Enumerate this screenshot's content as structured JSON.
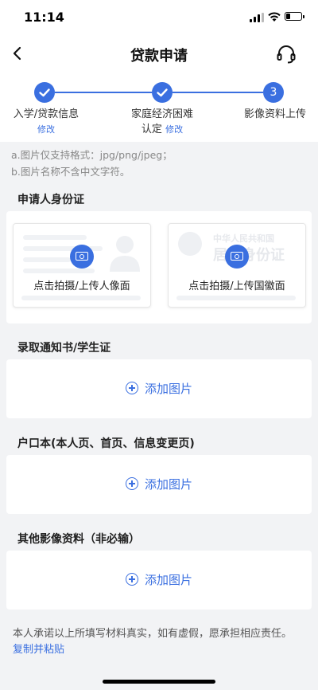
{
  "status_bar": {
    "time": "11:14"
  },
  "nav": {
    "title": "贷款申请",
    "back_icon": "chevron-left-icon",
    "support_icon": "headset-icon"
  },
  "steps": [
    {
      "label": "入学/贷款信息",
      "edit": "修改",
      "state": "done"
    },
    {
      "label_line1": "家庭经济困难",
      "label_line2": "认定",
      "edit": "修改",
      "state": "done"
    },
    {
      "number": "3",
      "label": "影像资料上传",
      "state": "current"
    }
  ],
  "notes": [
    "a.图片仅支持格式：jpg/png/jpeg；",
    "b.图片名称不含中文字符。"
  ],
  "sections": {
    "id_card": {
      "title": "申请人身份证",
      "front_label": "点击拍摄/上传人像面",
      "back_label": "点击拍摄/上传国徽面",
      "back_watermark_line1": "中华人民共和国",
      "back_watermark_line2": "居民身份证"
    },
    "admission": {
      "title": "录取通知书/学生证",
      "add_label": "添加图片"
    },
    "household": {
      "title": "户口本(本人页、首页、信息变更页)",
      "add_label": "添加图片"
    },
    "other": {
      "title": "其他影像资料（非必输）",
      "add_label": "添加图片"
    }
  },
  "footer": {
    "statement": "本人承诺以上所填写材料真实，如有虚假，愿承担相应责任。",
    "copy_link": "复制并粘贴"
  },
  "colors": {
    "accent": "#3a6fe0",
    "background": "#f2f3f5"
  }
}
